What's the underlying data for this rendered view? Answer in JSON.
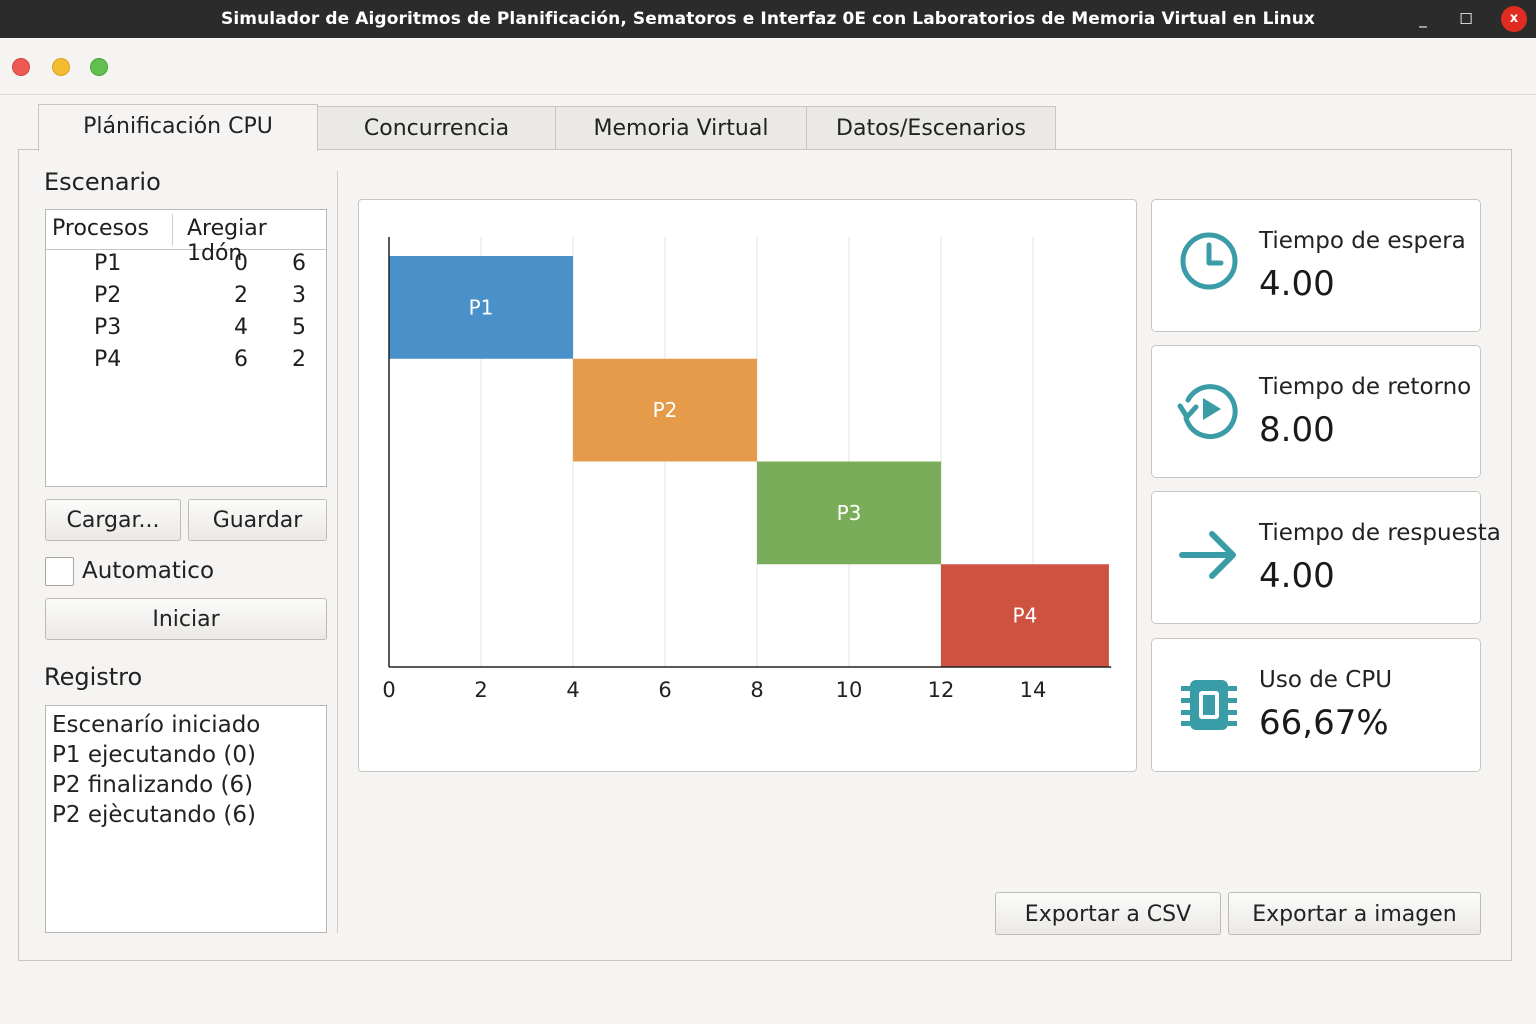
{
  "window": {
    "title": "Simulador de Aigoritmos de Planificación, Sematoros e Interfaz 0E con Laboratorios de Memoria Virtual en Linux",
    "minimize_glyph": "_",
    "maximize_glyph": "☐",
    "close_glyph": "x"
  },
  "tabs": [
    {
      "label": "Plánificación CPU",
      "active": true
    },
    {
      "label": "Concurrencia",
      "active": false
    },
    {
      "label": "Memoria Virtual",
      "active": false
    },
    {
      "label": "Datos/Escenarios",
      "active": false
    }
  ],
  "scenario": {
    "heading": "Escenario",
    "columns": [
      "Procesos",
      "Aregiar 1dón"
    ],
    "rows": [
      {
        "name": "P1",
        "a": "0",
        "b": "6"
      },
      {
        "name": "P2",
        "a": "2",
        "b": "3"
      },
      {
        "name": "P3",
        "a": "4",
        "b": "5"
      },
      {
        "name": "P4",
        "a": "6",
        "b": "2"
      }
    ],
    "load_button": "Cargar...",
    "save_button": "Guardar",
    "auto_label": "Automatico",
    "auto_checked": false,
    "start_button": "Iniciar"
  },
  "log": {
    "heading": "Registro",
    "lines": [
      "Escenarío iniciado",
      "P1 ejecutando (0)",
      "P2 finalizando (6)",
      "P2 ejècutando (6)"
    ]
  },
  "chart_data": {
    "type": "gantt",
    "x_ticks": [
      0,
      2,
      4,
      6,
      8,
      10,
      12,
      14
    ],
    "xlim": [
      0,
      15.7
    ],
    "grid": true,
    "bars": [
      {
        "name": "P1",
        "start": 0,
        "end": 4,
        "color": "#4a90c9"
      },
      {
        "name": "P2",
        "start": 4,
        "end": 8,
        "color": "#e69b4b"
      },
      {
        "name": "P3",
        "start": 8,
        "end": 12,
        "color": "#7aad5a"
      },
      {
        "name": "P4",
        "start": 12,
        "end": 15.65,
        "color": "#cd5240"
      }
    ]
  },
  "metrics": [
    {
      "label": "Tiempo de espera",
      "value": "4.00",
      "icon": "clock-icon"
    },
    {
      "label": "Tiempo de retorno",
      "value": "8.00",
      "icon": "history-icon"
    },
    {
      "label": "Tiempo de respuesta",
      "value": "4.00",
      "icon": "arrow-right-icon"
    },
    {
      "label": "Uso de CPU",
      "value": "66,67%",
      "icon": "cpu-chip-icon"
    }
  ],
  "accent_color": "#3a9ca6",
  "export": {
    "csv_button": "Exportar a CSV",
    "image_button": "Exportar a imagen"
  }
}
